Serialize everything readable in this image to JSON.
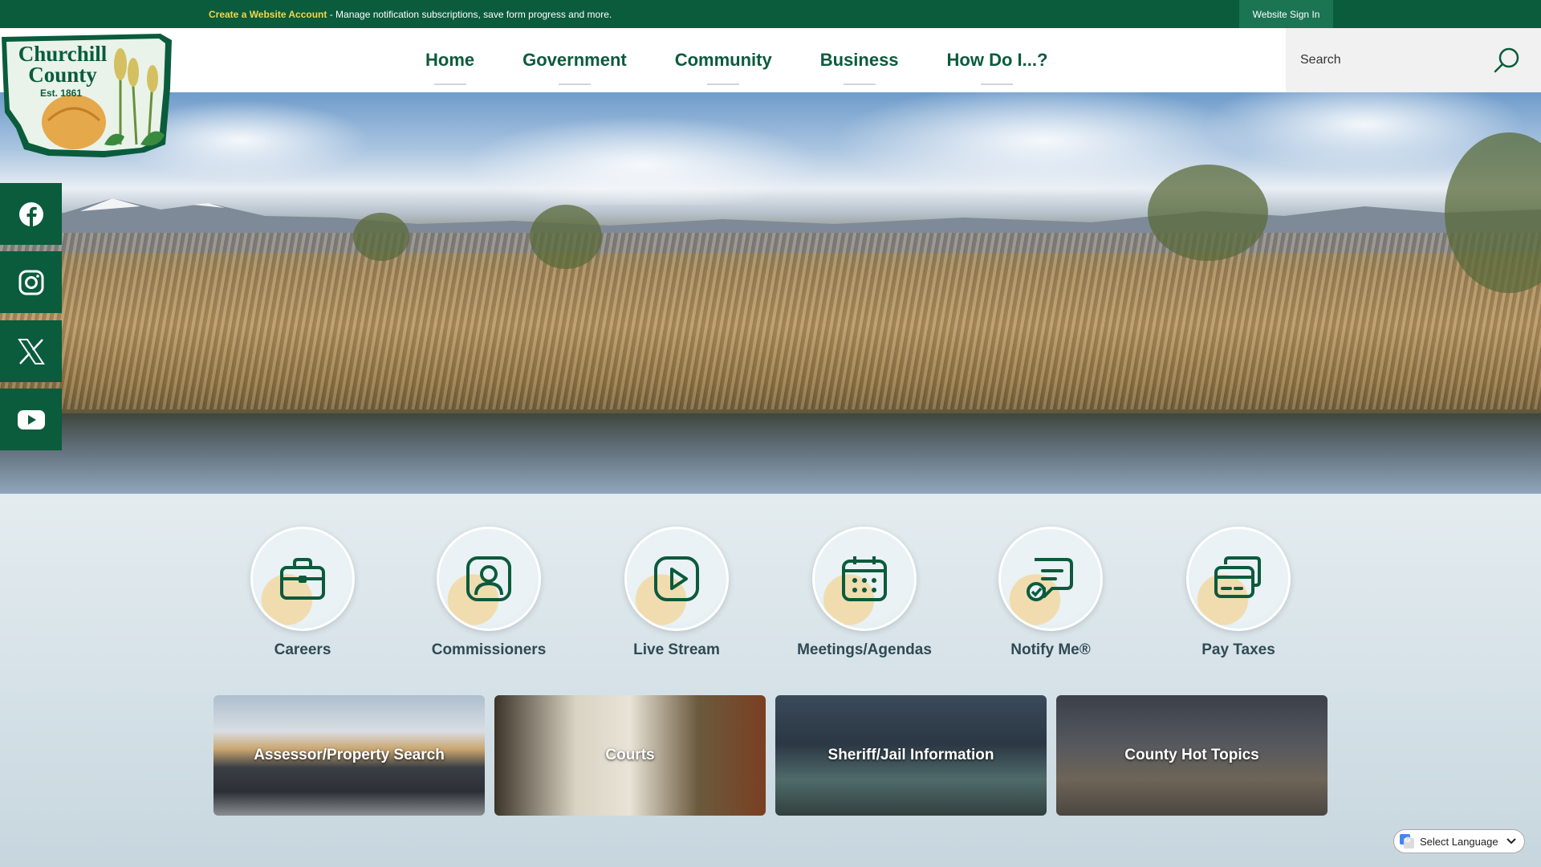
{
  "topbar": {
    "link_text": "Create a Website Account",
    "message": " - Manage notification subscriptions, save form progress and more.",
    "signin_label": "Website Sign In"
  },
  "logo": {
    "line1": "Churchill",
    "line2": "County",
    "est": "Est. 1861"
  },
  "nav": [
    {
      "label": "Home"
    },
    {
      "label": "Government"
    },
    {
      "label": "Community"
    },
    {
      "label": "Business"
    },
    {
      "label": "How Do I...?"
    }
  ],
  "search": {
    "placeholder": "Search",
    "icon": "search-icon"
  },
  "social": [
    {
      "icon": "facebook-icon"
    },
    {
      "icon": "instagram-icon"
    },
    {
      "icon": "x-twitter-icon"
    },
    {
      "icon": "youtube-icon"
    }
  ],
  "quick_links": [
    {
      "label": "Careers",
      "icon": "briefcase-icon"
    },
    {
      "label": "Commissioners",
      "icon": "user-icon"
    },
    {
      "label": "Live Stream",
      "icon": "play-icon"
    },
    {
      "label": "Meetings/Agendas",
      "icon": "calendar-icon"
    },
    {
      "label": "Notify Me®",
      "icon": "notify-icon"
    },
    {
      "label": "Pay Taxes",
      "icon": "cards-icon"
    }
  ],
  "tiles": [
    {
      "label": "Assessor/Property Search"
    },
    {
      "label": "Courts"
    },
    {
      "label": "Sheriff/Jail Information"
    },
    {
      "label": "County Hot Topics"
    }
  ],
  "language": {
    "label": "Select Language"
  },
  "colors": {
    "brand_green": "#0a5c3c",
    "nav_text": "#0b5b3c",
    "accent_yellow": "#f2d74a"
  }
}
